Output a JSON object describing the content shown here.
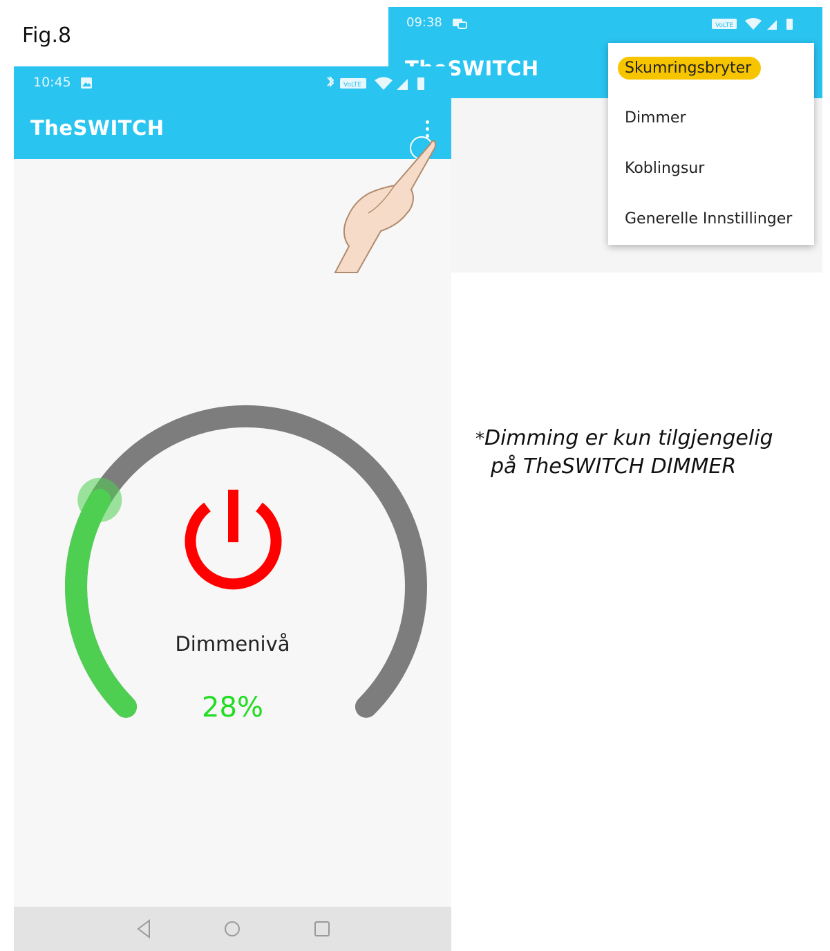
{
  "figure_label": "Fig.8",
  "back_screen": {
    "status_time": "09:38",
    "app_title": "TheSWITCH",
    "menu_items": [
      {
        "label": "Skumringsbryter",
        "highlighted": true
      },
      {
        "label": "Dimmer",
        "highlighted": false
      },
      {
        "label": "Koblingsur",
        "highlighted": false
      },
      {
        "label": "Generelle Innstillinger",
        "highlighted": false
      }
    ],
    "highlight_color": "#f7c400"
  },
  "front_screen": {
    "status_time": "10:45",
    "app_title": "TheSWITCH",
    "dimmer_label": "Dimmenivå",
    "dimmer_value": "28%",
    "dimmer_level": 0.28,
    "colors": {
      "appbar": "#29c4f0",
      "arc_active": "#4fcf52",
      "arc_track": "#7d7d7d",
      "power_icon": "#ff0000",
      "value_text": "#22dd22"
    },
    "icons": [
      "more-vert-icon",
      "power-icon",
      "back-icon",
      "home-icon",
      "recents-icon",
      "pointing-hand-icon"
    ]
  },
  "note": {
    "line1": "Dimming er kun tilgjengelig",
    "line2": "på TheSWITCH DIMMER"
  }
}
